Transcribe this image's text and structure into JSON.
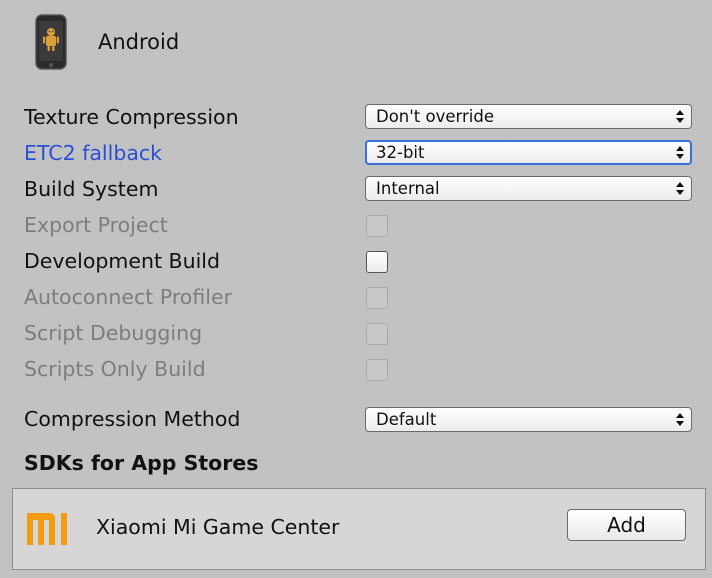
{
  "platform": {
    "title": "Android",
    "icon": "android-phone-icon"
  },
  "settings": {
    "texture_compression": {
      "label": "Texture Compression",
      "value": "Don't override"
    },
    "etc2_fallback": {
      "label": "ETC2 fallback",
      "value": "32-bit"
    },
    "build_system": {
      "label": "Build System",
      "value": "Internal"
    },
    "export_project": {
      "label": "Export Project",
      "checked": false,
      "enabled": false
    },
    "development_build": {
      "label": "Development Build",
      "checked": false,
      "enabled": true
    },
    "autoconnect_profiler": {
      "label": "Autoconnect Profiler",
      "checked": false,
      "enabled": false
    },
    "script_debugging": {
      "label": "Script Debugging",
      "checked": false,
      "enabled": false
    },
    "scripts_only_build": {
      "label": "Scripts Only Build",
      "checked": false,
      "enabled": false
    },
    "compression_method": {
      "label": "Compression Method",
      "value": "Default"
    }
  },
  "sdks": {
    "heading": "SDKs for App Stores",
    "items": [
      {
        "name": "Xiaomi Mi Game Center",
        "icon": "xiaomi-mi-logo",
        "button_label": "Add"
      }
    ]
  },
  "colors": {
    "background": "#c2c2c2",
    "highlight_label": "#2a4fd6",
    "disabled_label": "#7d7d7d",
    "focus_border": "#3d6fd8",
    "mi_orange": "#f39c12"
  }
}
